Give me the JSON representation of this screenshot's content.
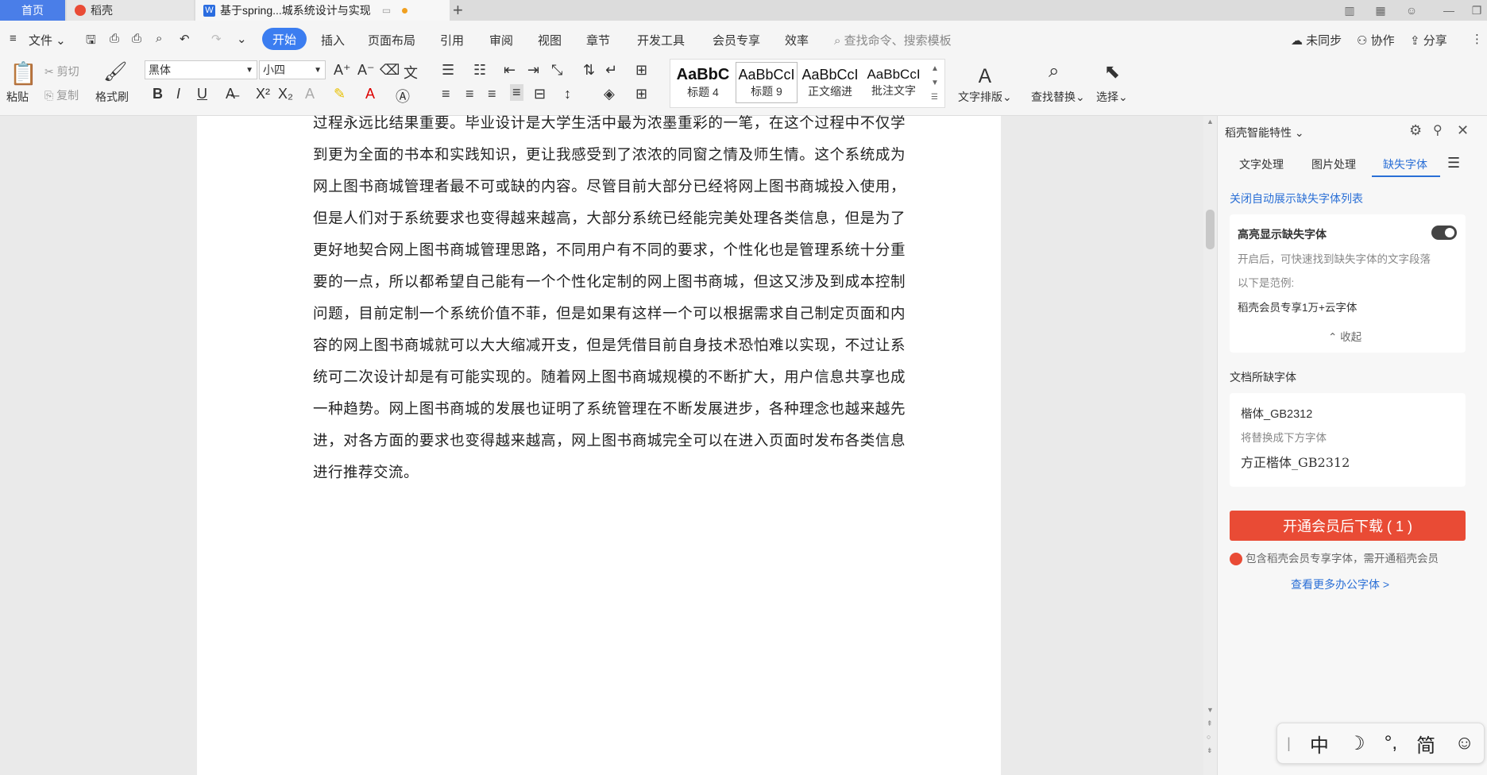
{
  "tabs": {
    "home": "首页",
    "daoke": "稻壳",
    "doc": "基于spring...城系统设计与实现",
    "new_tab": "+"
  },
  "menubar": {
    "file": "文件",
    "items": [
      "开始",
      "插入",
      "页面布局",
      "引用",
      "审阅",
      "视图",
      "章节",
      "开发工具",
      "会员专享",
      "效率"
    ],
    "search_placeholder": "查找命令、搜索模板",
    "unsynced": "未同步",
    "collab": "协作",
    "share": "分享"
  },
  "ribbon": {
    "paste": "粘贴",
    "cut": "剪切",
    "copy": "复制",
    "format_painter": "格式刷",
    "font_name": "黑体",
    "font_size": "小四",
    "styles": [
      {
        "sample": "AaBbC",
        "name": "标题 4"
      },
      {
        "sample": "AaBbCcI",
        "name": "标题 9"
      },
      {
        "sample": "AaBbCcI",
        "name": "正文缩进"
      },
      {
        "sample": "AaBbCcI",
        "name": "批注文字"
      }
    ],
    "text_layout": "文字排版",
    "find_replace": "查找替换",
    "select": "选择"
  },
  "document": {
    "paragraph": "过程永远比结果重要。毕业设计是大学生活中最为浓墨重彩的一笔，在这个过程中不仅学到更为全面的书本和实践知识，更让我感受到了浓浓的同窗之情及师生情。这个系统成为网上图书商城管理者最不可或缺的内容。尽管目前大部分已经将网上图书商城投入使用，但是人们对于系统要求也变得越来越高，大部分系统已经能完美处理各类信息，但是为了更好地契合网上图书商城管理思路，不同用户有不同的要求，个性化也是管理系统十分重要的一点，所以都希望自己能有一个个性化定制的网上图书商城，但这又涉及到成本控制问题，目前定制一个系统价值不菲，但是如果有这样一个可以根据需求自己制定页面和内容的网上图书商城就可以大大缩减开支，但是凭借目前自身技术恐怕难以实现，不过让系统可二次设计却是有可能实现的。随着网上图书商城规模的不断扩大，用户信息共享也成一种趋势。网上图书商城的发展也证明了系统管理在不断发展进步，各种理念也越来越先进，对各方面的要求也变得越来越高，网上图书商城完全可以在进入页面时发布各类信息进行推荐交流。"
  },
  "panel": {
    "title": "稻壳智能特性",
    "tabs": [
      "文字处理",
      "图片处理",
      "缺失字体"
    ],
    "active_tab": "缺失字体",
    "close_auto_link": "关闭自动展示缺失字体列表",
    "highlight_title": "高亮显示缺失字体",
    "highlight_desc": "开启后，可快速找到缺失字体的文字段落",
    "example_label": "以下是范例:",
    "example_text": "稻壳会员专享1万+云字体",
    "collapse": "收起",
    "doc_missing_title": "文档所缺字体",
    "missing_font": "楷体_GB2312",
    "replace_hint": "将替换成下方字体",
    "replacement_font": "方正楷体_GB2312",
    "download_button": "开通会员后下载 ( 1 )",
    "member_note": "包含稻壳会员专享字体，需开通稻壳会员",
    "more_fonts_link": "查看更多办公字体 >"
  },
  "ime": {
    "lang": "中",
    "moon": "☽",
    "punct": "°,",
    "simp": "简",
    "emoji": "☺"
  },
  "colors": {
    "accent": "#3b7df0",
    "download_red": "#e94b35",
    "link_blue": "#2a6fd6"
  }
}
